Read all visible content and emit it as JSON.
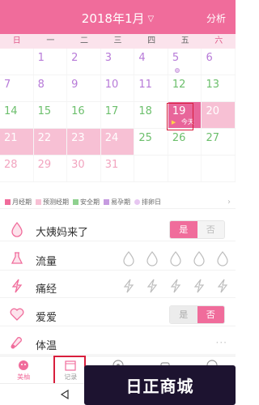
{
  "header": {
    "title": "2018年1月",
    "analysis_label": "分析"
  },
  "weekdays": [
    "日",
    "一",
    "二",
    "三",
    "四",
    "五",
    "六"
  ],
  "calendar": {
    "rows": [
      [
        {
          "d": ""
        },
        {
          "d": "1",
          "t": "fert"
        },
        {
          "d": "2",
          "t": "fert"
        },
        {
          "d": "3",
          "t": "fert"
        },
        {
          "d": "4",
          "t": "fert"
        },
        {
          "d": "5",
          "t": "fert",
          "ovu": true
        },
        {
          "d": "6",
          "t": "fert"
        }
      ],
      [
        {
          "d": "7",
          "t": "fert"
        },
        {
          "d": "8",
          "t": "fert"
        },
        {
          "d": "9",
          "t": "fert"
        },
        {
          "d": "10",
          "t": "fert"
        },
        {
          "d": "11",
          "t": "fert"
        },
        {
          "d": "12",
          "t": "safe"
        },
        {
          "d": "13",
          "t": "safe"
        }
      ],
      [
        {
          "d": "14",
          "t": "safe"
        },
        {
          "d": "15",
          "t": "safe"
        },
        {
          "d": "16",
          "t": "safe"
        },
        {
          "d": "17",
          "t": "safe"
        },
        {
          "d": "18",
          "t": "safe"
        },
        {
          "d": "19",
          "t": "today",
          "today": true
        },
        {
          "d": "20",
          "t": "pred"
        }
      ],
      [
        {
          "d": "21",
          "t": "pred"
        },
        {
          "d": "22",
          "t": "pred"
        },
        {
          "d": "23",
          "t": "pred"
        },
        {
          "d": "24",
          "t": "pred"
        },
        {
          "d": "25",
          "t": "safe"
        },
        {
          "d": "26",
          "t": "safe"
        },
        {
          "d": "27",
          "t": "safe"
        }
      ],
      [
        {
          "d": "28",
          "t": "nextm"
        },
        {
          "d": "29",
          "t": "nextm"
        },
        {
          "d": "30",
          "t": "nextm"
        },
        {
          "d": "31",
          "t": "nextm"
        },
        {
          "d": ""
        },
        {
          "d": ""
        },
        {
          "d": ""
        }
      ]
    ],
    "today_label": "今天"
  },
  "legend": [
    {
      "label": "月经期",
      "color": "#f06c9b"
    },
    {
      "label": "预测经期",
      "color": "#f7c0d4"
    },
    {
      "label": "安全期",
      "color": "#8fd18f"
    },
    {
      "label": "易孕期",
      "color": "#c69be0"
    },
    {
      "label": "排卵日",
      "color": "#e7c7f1",
      "round": true
    }
  ],
  "records": {
    "period": {
      "label": "大姨妈来了",
      "yes": "是",
      "no": "否",
      "selected": "yes"
    },
    "flow": {
      "label": "流量",
      "levels": 5
    },
    "pain": {
      "label": "痛经",
      "levels": 5
    },
    "love": {
      "label": "爱爱",
      "yes": "是",
      "no": "否",
      "selected": "no"
    },
    "temp": {
      "label": "体温",
      "more": "···"
    }
  },
  "tabs": [
    {
      "label": "美柚",
      "icon": "home-icon"
    },
    {
      "label": "记录",
      "icon": "calendar-icon"
    },
    {
      "label": "",
      "icon": "compass-icon"
    },
    {
      "label": "",
      "icon": "cart-icon"
    },
    {
      "label": "",
      "icon": "user-icon"
    }
  ],
  "watermark": "日正商城",
  "colors": {
    "accent": "#f06c9b",
    "predicted": "#f7c0d4",
    "safe": "#6cbf6c",
    "fertile": "#b77ad8",
    "highlight": "#d81e3c"
  }
}
